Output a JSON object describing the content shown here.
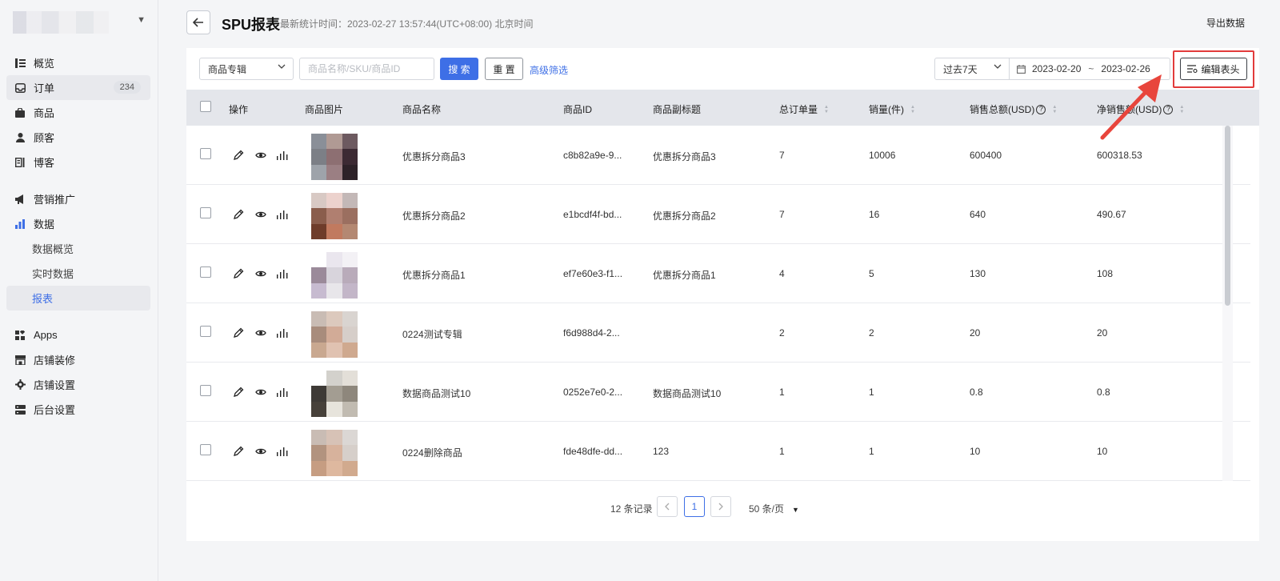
{
  "sidebar": {
    "items": [
      {
        "key": "overview",
        "label": "概览",
        "icon": "overview-icon"
      },
      {
        "key": "orders",
        "label": "订单",
        "icon": "inbox-icon",
        "badge": "234"
      },
      {
        "key": "products",
        "label": "商品",
        "icon": "bag-icon"
      },
      {
        "key": "customers",
        "label": "顾客",
        "icon": "person-icon"
      },
      {
        "key": "blog",
        "label": "博客",
        "icon": "blog-icon"
      },
      {
        "key": "marketing",
        "label": "营销推广",
        "icon": "megaphone-icon"
      },
      {
        "key": "data",
        "label": "数据",
        "icon": "bar-chart-icon"
      },
      {
        "key": "data-overview",
        "label": "数据概览"
      },
      {
        "key": "realtime",
        "label": "实时数据"
      },
      {
        "key": "reports",
        "label": "报表",
        "active": true
      },
      {
        "key": "apps",
        "label": "Apps",
        "icon": "apps-icon"
      },
      {
        "key": "decor",
        "label": "店铺装修",
        "icon": "storefront-icon"
      },
      {
        "key": "store-settings",
        "label": "店铺设置",
        "icon": "gear-icon"
      },
      {
        "key": "admin-settings",
        "label": "后台设置",
        "icon": "server-icon"
      }
    ]
  },
  "header": {
    "title": "SPU报表",
    "stat_time": "最新统计时间：2023-02-27 13:57:44(UTC+08:00) 北京时间",
    "export_label": "导出数据"
  },
  "filters": {
    "category_select": "商品专辑",
    "search_placeholder": "商品名称/SKU/商品ID",
    "search_label": "搜 索",
    "reset_label": "重 置",
    "advanced_label": "高级筛选",
    "range_select": "过去7天",
    "date_start": "2023-02-20",
    "date_sep": "~",
    "date_end": "2023-02-26",
    "edit_header_label": "编辑表头"
  },
  "table": {
    "columns": {
      "ops": "操作",
      "image": "商品图片",
      "name": "商品名称",
      "id": "商品ID",
      "subtitle": "商品副标题",
      "orders": "总订单量",
      "qty": "销量(件)",
      "gross": "销售总额(USD)",
      "net": "净销售额(USD)"
    },
    "rows": [
      {
        "name": "优惠拆分商品3",
        "id": "c8b82a9e-9...",
        "subtitle": "优惠拆分商品3",
        "orders": "7",
        "qty": "10006",
        "gross": "600400",
        "net": "600318.53"
      },
      {
        "name": "优惠拆分商品2",
        "id": "e1bcdf4f-bd...",
        "subtitle": "优惠拆分商品2",
        "orders": "7",
        "qty": "16",
        "gross": "640",
        "net": "490.67"
      },
      {
        "name": "优惠拆分商品1",
        "id": "ef7e60e3-f1...",
        "subtitle": "优惠拆分商品1",
        "orders": "4",
        "qty": "5",
        "gross": "130",
        "net": "108"
      },
      {
        "name": "0224测试专辑",
        "id": "f6d988d4-2...",
        "subtitle": "",
        "orders": "2",
        "qty": "2",
        "gross": "20",
        "net": "20"
      },
      {
        "name": "数据商品测试10",
        "id": "0252e7e0-2...",
        "subtitle": "数据商品测试10",
        "orders": "1",
        "qty": "1",
        "gross": "0.8",
        "net": "0.8"
      },
      {
        "name": "0224删除商品",
        "id": "fde48dfe-dd...",
        "subtitle": "123",
        "orders": "1",
        "qty": "1",
        "gross": "10",
        "net": "10"
      }
    ]
  },
  "pagination": {
    "total": "12 条记录",
    "current": "1",
    "page_size": "50 条/页"
  },
  "colors": {
    "accent": "#3e6fe6",
    "highlight": "#e23b3b"
  }
}
